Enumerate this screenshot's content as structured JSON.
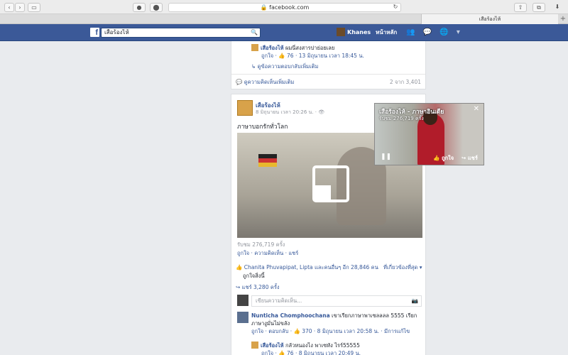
{
  "browser": {
    "url": "🔒 facebook.com",
    "tab_title": "เสือร้องไห้",
    "back": "‹",
    "forward": "›",
    "sidebar": "▭",
    "reload": "↻",
    "share": "⇧",
    "tabs": "⧉",
    "downloads": "⬇",
    "new_tab": "+"
  },
  "header": {
    "logo": "f",
    "search_value": "เสือร้องไห้",
    "search_icon": "🔍",
    "user_name": "Khanes",
    "home": "หน้าหลัก",
    "icons": "👥 💬 🌐 ▾"
  },
  "prev_post": {
    "reply_name": "เสือร้องไห้",
    "reply_text": " ผมนี่สงสารปาย่อยเลย",
    "reply_meta": "ถูกใจ · 👍 76 · 13 มิถุนายน เวลา 18:45 น.",
    "more_replies": "↳ ดูข้อความตอบกลับเพิ่มเติม",
    "view_more_comments": "💬 ดูความคิดเห็นเพิ่มเติม",
    "comment_count": "2 จาก 3,401"
  },
  "post": {
    "author": "เสือร้องไห้",
    "time": "8 มิถุนายน เวลา 20:26 น. · 👁",
    "text": "ภาษาบอกรักทั่วโลก",
    "views": "รับชม 276,719 ครั้ง",
    "actions": "ถูกใจ · ความคิดเห็น · แชร์",
    "likes": "👍 Chanita Phuvapipat, Lipta และคนอื่นๆ อีก 28,846 คน",
    "likes_line2": "ถูกใจสิ่งนี้",
    "sort": "ที่เกี่ยวข้องที่สุด ▾",
    "shares": "↪ แชร์ 3,280 ครั้ง",
    "comment_placeholder": "เขียนความคิดเห็น...",
    "camera_icon": "📷"
  },
  "comment1": {
    "name": "Nunticha Chomphoochana",
    "text": " เขาเรียกภาษาพาเซลลลล 5555 เรียก ภาษางูมั่นไม่ขลัง",
    "meta": "ถูกใจ · ตอบกลับ · 👍 370 · 8 มิถุนายน เวลา 20:58 น. · มีการแก้ไข"
  },
  "reply1": {
    "name": "เสือร้องไห้",
    "text": " กลัวหนองไง พาเซหัง ไรร์55555",
    "meta": "ถูกใจ · 👍 76 · 8 มิถุนายน เวลา 20:49 น."
  },
  "pip": {
    "title": "เสือร้องไห้ - ภาษาอินเดีย",
    "subtitle": "รับชม 276,719 ครั้ง",
    "close": "✕",
    "pause": "❚❚",
    "like": "👍 ถูกใจ",
    "share": "↪ แชร์"
  }
}
